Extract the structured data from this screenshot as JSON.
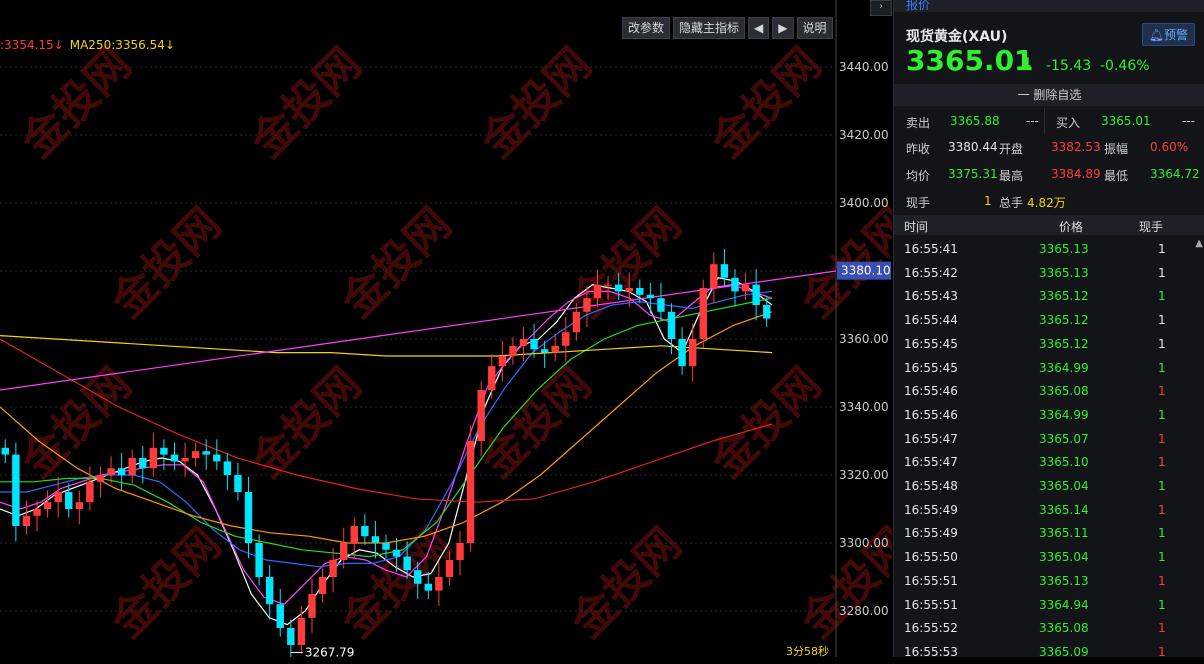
{
  "chart": {
    "ma_legend": [
      {
        "label": ":3354.15↓",
        "color": "#ff3b3b"
      },
      {
        "label": "MA250:3356.54↓",
        "color": "#f5d400"
      }
    ],
    "toolbar": {
      "params": "改参数",
      "hide_indicator": "隐藏主指标",
      "prev": "◀",
      "next": "▶",
      "help": "说明"
    },
    "expand_icon": "›",
    "y_axis_ticks": [
      "3440.00",
      "3420.00",
      "3400.00",
      "3380.00",
      "3360.00",
      "3340.00",
      "3320.00",
      "3300.00",
      "3280.00"
    ],
    "prev_close_tag": "3380.10",
    "low_label": "3267.79",
    "countdown": "3分58秒",
    "watermark": "金投网",
    "colors": {
      "up": "#ff3b3b",
      "down": "#00e5ff"
    }
  },
  "chart_data": {
    "type": "candlestick",
    "ylim": [
      3270,
      3445
    ],
    "y_ticks": [
      3440,
      3420,
      3400,
      3380,
      3360,
      3340,
      3320,
      3300,
      3280
    ],
    "prev_close": 3380.1,
    "low_marker": 3267.79,
    "close_path": [
      3326,
      3305,
      3308,
      3310,
      3312,
      3315,
      3310,
      3312,
      3318,
      3320,
      3322,
      3320,
      3325,
      3322,
      3328,
      3326,
      3324,
      3325,
      3327,
      3326,
      3324,
      3320,
      3315,
      3300,
      3290,
      3282,
      3275,
      3270,
      3278,
      3285,
      3290,
      3295,
      3300,
      3305,
      3302,
      3300,
      3298,
      3296,
      3292,
      3288,
      3286,
      3290,
      3295,
      3300,
      3330,
      3345,
      3352,
      3355,
      3358,
      3360,
      3357,
      3356,
      3358,
      3362,
      3368,
      3372,
      3376,
      3376,
      3374,
      3375,
      3373,
      3372,
      3368,
      3360,
      3352,
      3360,
      3375,
      3382,
      3378,
      3374,
      3376,
      3370,
      3366
    ],
    "series": [
      {
        "name": "MA5",
        "color": "#ffffff",
        "values": [
          3310,
          3308,
          3310,
          3314,
          3316,
          3318,
          3320,
          3322,
          3324,
          3325,
          3324,
          3320,
          3310,
          3298,
          3285,
          3278,
          3276,
          3280,
          3288,
          3295,
          3298,
          3297,
          3293,
          3290,
          3291,
          3300,
          3320,
          3340,
          3352,
          3358,
          3360,
          3365,
          3372,
          3376,
          3375,
          3374,
          3371,
          3360,
          3356,
          3368,
          3378,
          3377,
          3374,
          3370
        ]
      },
      {
        "name": "MA10",
        "color": "#ff40ff",
        "values": [
          3312,
          3310,
          3312,
          3316,
          3318,
          3320,
          3321,
          3322,
          3323,
          3323,
          3318,
          3305,
          3292,
          3284,
          3282,
          3288,
          3294,
          3296,
          3295,
          3292,
          3290,
          3296,
          3312,
          3330,
          3346,
          3354,
          3360,
          3366,
          3371,
          3374,
          3374,
          3372,
          3367,
          3365,
          3370,
          3375,
          3376,
          3374,
          3372
        ]
      },
      {
        "name": "MA20",
        "color": "#2f6bff",
        "values": [
          3315,
          3315,
          3317,
          3319,
          3320,
          3320,
          3318,
          3312,
          3304,
          3298,
          3295,
          3294,
          3293,
          3294,
          3294,
          3296,
          3304,
          3318,
          3334,
          3346,
          3356,
          3362,
          3367,
          3370,
          3371,
          3370,
          3369,
          3371,
          3373,
          3374
        ]
      },
      {
        "name": "MA30",
        "color": "#22dd22",
        "values": [
          3318,
          3318,
          3319,
          3319,
          3317,
          3312,
          3306,
          3302,
          3300,
          3298,
          3297,
          3296,
          3298,
          3306,
          3320,
          3334,
          3345,
          3354,
          3360,
          3364,
          3366,
          3368,
          3370,
          3372
        ]
      },
      {
        "name": "MA60",
        "color": "#ff9900",
        "values": [
          3340,
          3330,
          3322,
          3316,
          3312,
          3308,
          3305,
          3303,
          3302,
          3300,
          3300,
          3302,
          3306,
          3312,
          3320,
          3330,
          3340,
          3350,
          3358,
          3364,
          3368
        ]
      },
      {
        "name": "MA120",
        "color": "#dd2222",
        "values": [
          3360,
          3350,
          3340,
          3332,
          3325,
          3320,
          3316,
          3313,
          3312,
          3313,
          3318,
          3324,
          3330,
          3335
        ]
      },
      {
        "name": "MA250",
        "color": "#f5d400",
        "values": [
          3361,
          3360,
          3359,
          3358,
          3357,
          3356,
          3356,
          3355,
          3355,
          3355,
          3356,
          3357,
          3358,
          3357,
          3356
        ]
      },
      {
        "name": "trendline",
        "color": "#ff40ff",
        "values": [
          3345,
          3380
        ]
      }
    ]
  },
  "panel": {
    "tab": "报价",
    "title": "现货黄金(XAU)",
    "alert": "预警",
    "price": "3365.01",
    "arrow": "⬇",
    "change": "-15.43",
    "change_pct": "-0.46%",
    "watchlist": "一 删除自选",
    "sell_label": "卖出",
    "sell": "3365.88",
    "sell_vol": "---",
    "buy_label": "买入",
    "buy": "3365.01",
    "buy_vol": "---",
    "stats": [
      [
        {
          "label": "昨收",
          "value": "3380.44",
          "cls": "white"
        },
        {
          "label": "开盘",
          "value": "3382.53",
          "cls": "red"
        },
        {
          "label": "振幅",
          "value": "0.60%",
          "cls": "red"
        }
      ],
      [
        {
          "label": "均价",
          "value": "3375.31",
          "cls": "green"
        },
        {
          "label": "最高",
          "value": "3384.89",
          "cls": "red"
        },
        {
          "label": "最低",
          "value": "3364.72",
          "cls": "green"
        }
      ],
      [
        {
          "label": "现手",
          "value": "1",
          "cls": "yellow"
        },
        {
          "label": "总手",
          "value": "4.82万",
          "cls": "yellow"
        }
      ]
    ],
    "ticks_head": {
      "time": "时间",
      "price": "价格",
      "vol": "现手"
    },
    "ticks": [
      {
        "time": "16:55:41",
        "price": "3365.13",
        "vol": "1",
        "vc": "white"
      },
      {
        "time": "16:55:42",
        "price": "3365.13",
        "vol": "1",
        "vc": "white"
      },
      {
        "time": "16:55:43",
        "price": "3365.12",
        "vol": "1",
        "vc": "green"
      },
      {
        "time": "16:55:44",
        "price": "3365.12",
        "vol": "1",
        "vc": "white"
      },
      {
        "time": "16:55:45",
        "price": "3365.12",
        "vol": "1",
        "vc": "white"
      },
      {
        "time": "16:55:45",
        "price": "3364.99",
        "vol": "1",
        "vc": "green"
      },
      {
        "time": "16:55:46",
        "price": "3365.08",
        "vol": "1",
        "vc": "red"
      },
      {
        "time": "16:55:46",
        "price": "3364.99",
        "vol": "1",
        "vc": "green"
      },
      {
        "time": "16:55:47",
        "price": "3365.07",
        "vol": "1",
        "vc": "red"
      },
      {
        "time": "16:55:47",
        "price": "3365.10",
        "vol": "1",
        "vc": "red"
      },
      {
        "time": "16:55:48",
        "price": "3365.04",
        "vol": "1",
        "vc": "green"
      },
      {
        "time": "16:55:49",
        "price": "3365.14",
        "vol": "1",
        "vc": "red"
      },
      {
        "time": "16:55:49",
        "price": "3365.11",
        "vol": "1",
        "vc": "green"
      },
      {
        "time": "16:55:50",
        "price": "3365.04",
        "vol": "1",
        "vc": "green"
      },
      {
        "time": "16:55:51",
        "price": "3365.13",
        "vol": "1",
        "vc": "red"
      },
      {
        "time": "16:55:51",
        "price": "3364.94",
        "vol": "1",
        "vc": "green"
      },
      {
        "time": "16:55:52",
        "price": "3365.08",
        "vol": "1",
        "vc": "red"
      },
      {
        "time": "16:55:53",
        "price": "3365.09",
        "vol": "1",
        "vc": "red"
      }
    ]
  }
}
